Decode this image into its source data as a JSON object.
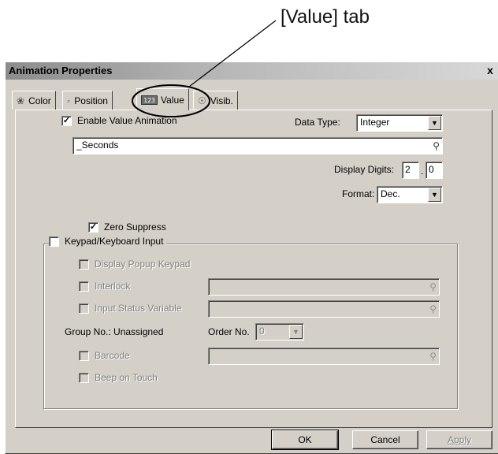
{
  "annotation": {
    "label": "[Value] tab"
  },
  "window": {
    "title": "Animation Properties",
    "close_glyph": "x"
  },
  "tabs": [
    {
      "label": "Color",
      "icon": "color-wheel-icon"
    },
    {
      "label": "Position",
      "icon": "position-icon"
    },
    {
      "label": "Value",
      "icon": "value-123-icon",
      "icon_text": "123"
    },
    {
      "label": "Visib.",
      "icon": "visibility-icon"
    }
  ],
  "value_tab": {
    "enable_value_animation": {
      "label": "Enable Value Animation",
      "checked": true
    },
    "data_type": {
      "label": "Data Type:",
      "value": "Integer"
    },
    "variable": {
      "value": "_Seconds"
    },
    "display_digits": {
      "label": "Display Digits:",
      "integer": "2",
      "separator": ".",
      "fraction": "0"
    },
    "format": {
      "label": "Format:",
      "value": "Dec."
    },
    "zero_suppress": {
      "label": "Zero Suppress",
      "checked": true
    },
    "keypad": {
      "label": "Keypad/Keyboard Input",
      "checked": false,
      "display_popup_keypad": "Display Popup Keypad",
      "interlock": "Interlock",
      "input_status_variable": "Input Status Variable",
      "group_no": "Group No.:  Unassigned",
      "order_no_label": "Order No.",
      "order_no_value": "0",
      "barcode": "Barcode",
      "beep_on_touch": "Beep on Touch"
    }
  },
  "buttons": {
    "ok": "OK",
    "cancel": "Cancel",
    "apply": "Apply"
  },
  "colors": {
    "dialog_bg": "#d4d0c8",
    "disabled_text": "#808080"
  }
}
